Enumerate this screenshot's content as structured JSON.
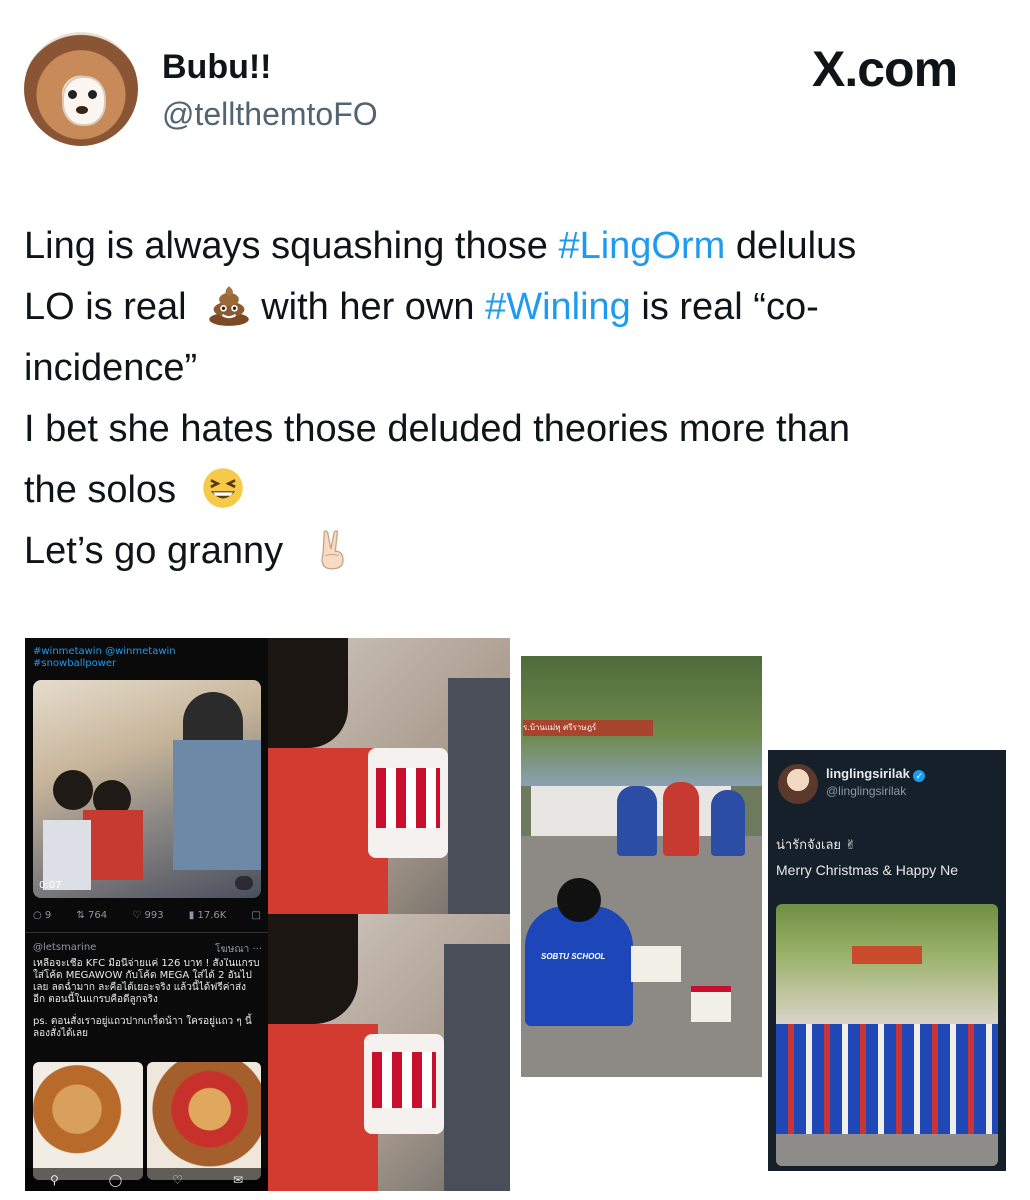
{
  "header": {
    "display_name": "Bubu!!",
    "handle": "@tellthemtoFO",
    "site_logo": "X.com"
  },
  "tweet": {
    "line1_a": "Ling is always squashing those ",
    "hashtag1": "#LingOrm",
    "line1_b": " delulus",
    "line2_a": "LO is real",
    "line2_b": "with her own ",
    "hashtag2": "#Winling",
    "line2_c": " is real “co-",
    "line3": "incidence”",
    "line4": "I bet she hates those deluded theories more than",
    "line5": "the solos",
    "line6": "Let’s go granny",
    "emojis": [
      "pile-of-poo-icon",
      "grinning-squinting-face-icon",
      "victory-hand-icon"
    ]
  },
  "media": {
    "panel1": {
      "hashtags": "#winmetawin @winmetawin",
      "hashtag2": "#snowballpower",
      "duration": "0:07",
      "stats": [
        "9",
        "764",
        "993",
        "17.6K"
      ],
      "ad_handle": "@letsmarine",
      "ad_label": "โฆษณา ···",
      "ad_text": [
        "เหลือจะเชื่อ KFC มื้อนี้จ่ายแค่ 126 บาท ! สั่งในแกรบ",
        "ใส่โค้ด MEGAWOW กับโค้ด MEGA ใส่ได้ 2 อันไป",
        "เลย ลดฉ่ำมาก ละคือได้เยอะจริง แล้วนี้ได้ฟรีค่าส่ง",
        "อีก ตอนนี้ในแกรบคือดีลูกจริง"
      ],
      "ad_ps": [
        "ps. ตอนสั่งเราอยู่แถวปากเกร็ดน้าา ใครอยู่แถว ๆ นี้",
        "ลองสั่งได้เลย"
      ]
    },
    "panel3": {
      "sign_text": "ร.บ้านแม่ทุ ศรีราษฎร์",
      "shirt_text": "SOBTU SCHOOL"
    },
    "panel4": {
      "name": "linglingsirilak",
      "handle": "@linglingsirilak",
      "line1": "น่ารักจังเลย",
      "line2": "Merry Christmas & Happy Ne"
    }
  },
  "colors": {
    "hashtag": "#1d9bf0",
    "handle": "#536471",
    "text": "#0f1419"
  }
}
